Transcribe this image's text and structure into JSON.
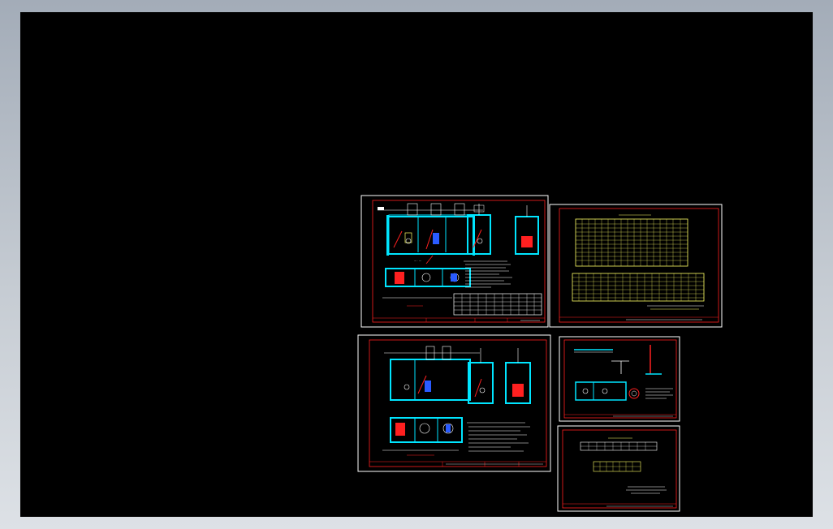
{
  "viewer": {
    "background": "#000000",
    "sheet_frame_color": "#ffffff",
    "sheet_border_color": "#ff2020"
  },
  "sheets": [
    {
      "id": "sheet-1",
      "content": "tank-sections-with-table"
    },
    {
      "id": "sheet-2",
      "content": "schedule-tables"
    },
    {
      "id": "sheet-3",
      "content": "tank-sections"
    },
    {
      "id": "sheet-4",
      "content": "details"
    },
    {
      "id": "sheet-5",
      "content": "notes-and-table"
    }
  ],
  "colors": {
    "cyan": "#00e5ff",
    "yellow": "#ffff66",
    "red": "#ff2020",
    "white": "#ffffff",
    "blue": "#2a5bff"
  }
}
